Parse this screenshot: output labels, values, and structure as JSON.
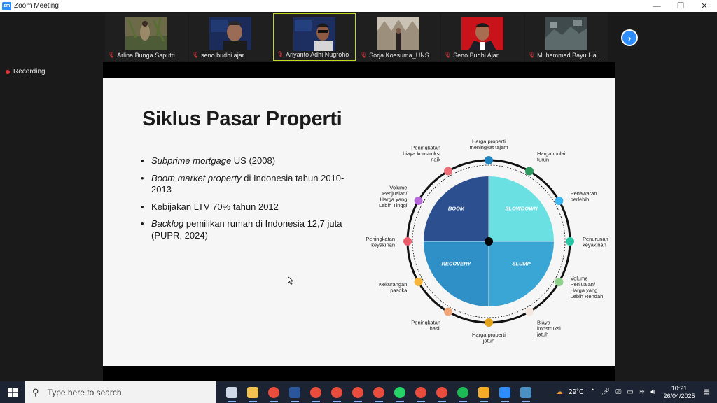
{
  "window": {
    "title": "Zoom Meeting",
    "logo": "zm",
    "minimize": "—",
    "restore": "❐",
    "close": "✕"
  },
  "participants": [
    {
      "name": "Arlina Bunga Saputri",
      "active": false
    },
    {
      "name": "seno budhi ajar",
      "active": false
    },
    {
      "name": "Ariyanto Adhi Nugroho",
      "active": true
    },
    {
      "name": "Sorja Koesuma_UNS",
      "active": false
    },
    {
      "name": "Seno Budhi Ajar",
      "active": false
    },
    {
      "name": "Muhammad Bayu Ha...",
      "active": false
    }
  ],
  "recording_label": "Recording",
  "slide": {
    "title": "Siklus Pasar Properti",
    "bullets": [
      {
        "em": "Subprime mortgage",
        "rest": " US (2008)"
      },
      {
        "em": "Boom market property",
        "rest": " di Indonesia tahun 2010-2013"
      },
      {
        "em": "",
        "rest": "Kebijakan LTV 70% tahun 2012"
      },
      {
        "em": "Backlog",
        "rest": " pemilikan rumah di Indonesia 12,7 juta (PUPR, 2024)"
      }
    ],
    "quadrants": [
      {
        "label": "BOOM",
        "color": "#2b4f8f"
      },
      {
        "label": "SLOWDOWN",
        "color": "#6be0e2"
      },
      {
        "label": "RECOVERY",
        "color": "#2f8fc7"
      },
      {
        "label": "SLUMP",
        "color": "#3aa6d6"
      }
    ],
    "phases": [
      {
        "label": "Harga properti meningkat tajam",
        "lines": [
          "Harga properti",
          "meningkat tajam"
        ],
        "color": "#1f84c0"
      },
      {
        "label": "Harga mulai turun",
        "lines": [
          "Harga mulai",
          "turun"
        ],
        "color": "#2a9a5e"
      },
      {
        "label": "Penawaran berlebih",
        "lines": [
          "Penawaran",
          "berlebih"
        ],
        "color": "#3db6f2"
      },
      {
        "label": "Penurunan keyakinan",
        "lines": [
          "Penurunan",
          "keyakinan"
        ],
        "color": "#28c7a3"
      },
      {
        "label": "Volume Penjualan/ Harga yang Lebih Rendah",
        "lines": [
          "Volume",
          "Penjualan/",
          "Harga yang",
          "Lebih Rendah"
        ],
        "color": "#8fd18a"
      },
      {
        "label": "Biaya konstruksi jatuh",
        "lines": [
          "Biaya",
          "konstruksi",
          "jatuh"
        ],
        "color": "#f6e6e0"
      },
      {
        "label": "Harga properti jatuh",
        "lines": [
          "Harga properti",
          "jatuh"
        ],
        "color": "#e2a41a"
      },
      {
        "label": "Peningkatan hasil",
        "lines": [
          "Peningkatan",
          "hasil"
        ],
        "color": "#f2a77a"
      },
      {
        "label": "Kekurangan pasoka",
        "lines": [
          "Kekurangan",
          "pasoka"
        ],
        "color": "#f7b53a"
      },
      {
        "label": "Peningkatan keyakinan",
        "lines": [
          "Peningkatan",
          "keyakinan"
        ],
        "color": "#ee5b6b"
      },
      {
        "label": "Volume Penjualan/ Harga yang Lebih Tinggi",
        "lines": [
          "Volume",
          "Penjualan/",
          "Harga yang",
          "Lebih Tinggi"
        ],
        "color": "#b66ad9"
      },
      {
        "label": "Peningkatan biaya konstruksi naik",
        "lines": [
          "Peningkatan",
          "biaya konstruksi",
          "naik"
        ],
        "color": "#ee6f7a"
      }
    ]
  },
  "taskbar": {
    "search_placeholder": "Type here to search",
    "apps": [
      "task-view",
      "file-explorer",
      "chrome",
      "word",
      "chrome",
      "chrome",
      "chrome",
      "chrome",
      "whatsapp",
      "chrome",
      "chrome",
      "spotify",
      "notes",
      "zoom",
      "photos"
    ],
    "weather": "29°C",
    "time": "10:21",
    "date": "26/04/2025"
  }
}
